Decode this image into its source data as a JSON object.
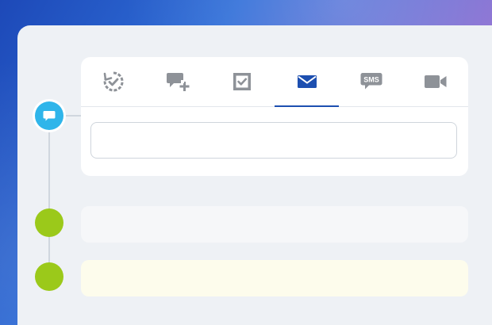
{
  "composer": {
    "tabs": [
      {
        "name": "activity",
        "icon": "refresh-check-icon",
        "active": false
      },
      {
        "name": "add-note",
        "icon": "comment-plus-icon",
        "active": false
      },
      {
        "name": "task",
        "icon": "checkbox-icon",
        "active": false
      },
      {
        "name": "email",
        "icon": "envelope-icon",
        "active": true
      },
      {
        "name": "sms",
        "icon": "sms-icon",
        "label": "SMS",
        "active": false
      },
      {
        "name": "video",
        "icon": "video-camera-icon",
        "active": false
      }
    ],
    "input_value": "",
    "input_placeholder": ""
  },
  "timeline": {
    "current_icon": "chat-bubble-icon"
  },
  "colors": {
    "accent": "#1d4fb0",
    "icon_gray": "#8e9298",
    "chat_node": "#2fb5ea",
    "green_node": "#9bc91a",
    "yellow_card": "#fdfcec",
    "panel_bg": "#eef1f5"
  }
}
